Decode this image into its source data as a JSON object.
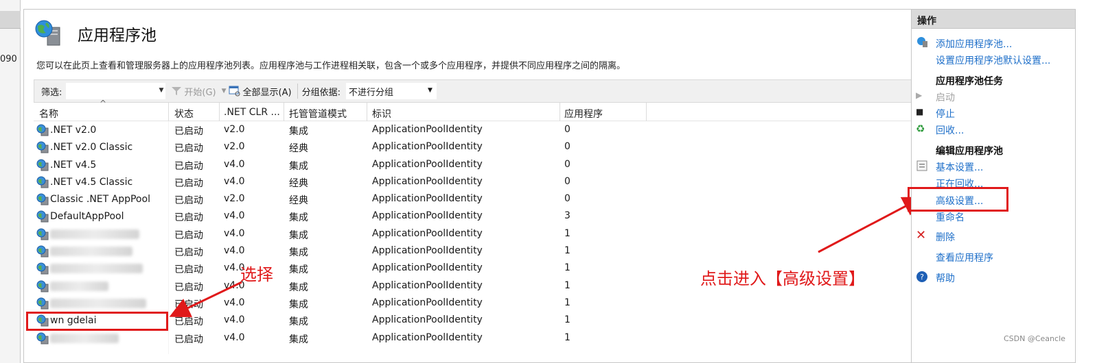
{
  "left_strip": {
    "text": "090"
  },
  "header": {
    "title": "应用程序池",
    "description": "您可以在此页上查看和管理服务器上的应用程序池列表。应用程序池与工作进程相关联，包含一个或多个应用程序，并提供不同应用程序之间的隔离。"
  },
  "toolbar": {
    "filter_label": "筛选:",
    "filter_value": "",
    "start_label": "开始(G)",
    "show_all_label": "全部显示(A)",
    "group_by_label": "分组依据:",
    "group_by_value": "不进行分组"
  },
  "columns": [
    "名称",
    "状态",
    ".NET CLR ...",
    "托管管道模式",
    "标识",
    "应用程序"
  ],
  "rows": [
    {
      "name": ".NET v2.0",
      "status": "已启动",
      "clr": "v2.0",
      "mode": "集成",
      "identity": "ApplicationPoolIdentity",
      "apps": "0"
    },
    {
      "name": ".NET v2.0 Classic",
      "status": "已启动",
      "clr": "v2.0",
      "mode": "经典",
      "identity": "ApplicationPoolIdentity",
      "apps": "0"
    },
    {
      "name": ".NET v4.5",
      "status": "已启动",
      "clr": "v4.0",
      "mode": "集成",
      "identity": "ApplicationPoolIdentity",
      "apps": "0"
    },
    {
      "name": ".NET v4.5 Classic",
      "status": "已启动",
      "clr": "v4.0",
      "mode": "经典",
      "identity": "ApplicationPoolIdentity",
      "apps": "0"
    },
    {
      "name": "Classic .NET AppPool",
      "status": "已启动",
      "clr": "v2.0",
      "mode": "经典",
      "identity": "ApplicationPoolIdentity",
      "apps": "0"
    },
    {
      "name": "DefaultAppPool",
      "status": "已启动",
      "clr": "v4.0",
      "mode": "集成",
      "identity": "ApplicationPoolIdentity",
      "apps": "3"
    },
    {
      "name": "",
      "status": "已启动",
      "clr": "v4.0",
      "mode": "集成",
      "identity": "ApplicationPoolIdentity",
      "apps": "1"
    },
    {
      "name": "",
      "status": "已启动",
      "clr": "v4.0",
      "mode": "集成",
      "identity": "ApplicationPoolIdentity",
      "apps": "1"
    },
    {
      "name": "",
      "status": "已启动",
      "clr": "v4.0",
      "mode": "集成",
      "identity": "ApplicationPoolIdentity",
      "apps": "1"
    },
    {
      "name": "",
      "status": "已启动",
      "clr": "v4.0",
      "mode": "集成",
      "identity": "ApplicationPoolIdentity",
      "apps": "1"
    },
    {
      "name": "",
      "status": "已启动",
      "clr": "v4.0",
      "mode": "集成",
      "identity": "ApplicationPoolIdentity",
      "apps": "1"
    },
    {
      "name": "wn  gdelai",
      "status": "已启动",
      "clr": "v4.0",
      "mode": "集成",
      "identity": "ApplicationPoolIdentity",
      "apps": "1"
    },
    {
      "name": "",
      "status": "已启动",
      "clr": "v4.0",
      "mode": "集成",
      "identity": "ApplicationPoolIdentity",
      "apps": "1"
    }
  ],
  "annotations": {
    "select": "选择",
    "advanced": "点击进入【高级设置】"
  },
  "actions": {
    "header": "操作",
    "add_pool": "添加应用程序池...",
    "set_defaults": "设置应用程序池默认设置...",
    "tasks_title": "应用程序池任务",
    "start": "启动",
    "stop": "停止",
    "recycle": "回收...",
    "edit_title": "编辑应用程序池",
    "basic": "基本设置...",
    "recycling": "正在回收...",
    "advanced": "高级设置...",
    "rename": "重命名",
    "delete": "删除",
    "view_apps": "查看应用程序",
    "help": "帮助"
  },
  "watermark": "CSDN @Ceancle",
  "colors": {
    "accent_red": "#e0191a",
    "link_blue": "#1e6fc9"
  }
}
